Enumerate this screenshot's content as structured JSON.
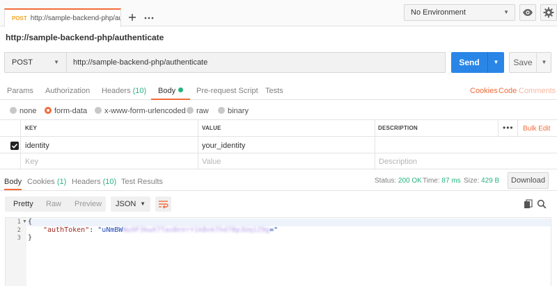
{
  "tabbar": {
    "active_tab": {
      "method": "POST",
      "url": "http://sample-backend-php/au"
    },
    "new_tab_icon": "plus-icon",
    "more_icon": "ellipsis-icon"
  },
  "environment": {
    "selected": "No Environment",
    "eye_icon": "eye-icon",
    "settings_icon": "gear-icon"
  },
  "request": {
    "title": "http://sample-backend-php/authenticate",
    "method": "POST",
    "url": "http://sample-backend-php/authenticate",
    "send_label": "Send",
    "save_label": "Save"
  },
  "request_tabs": {
    "params": "Params",
    "authorization": "Authorization",
    "headers": "Headers",
    "headers_count": "(10)",
    "body": "Body",
    "prerequest": "Pre-request Script",
    "tests": "Tests",
    "cookies": "Cookies",
    "code": "Code",
    "comments": "Comments"
  },
  "body_types": {
    "none": "none",
    "form_data": "form-data",
    "urlencoded": "x-www-form-urlencoded",
    "raw": "raw",
    "binary": "binary",
    "selected": "form-data"
  },
  "kv_table": {
    "headers": {
      "key": "KEY",
      "value": "VALUE",
      "description": "DESCRIPTION",
      "bulk_edit": "Bulk Edit"
    },
    "rows": [
      {
        "checked": true,
        "key": "identity",
        "value": "your_identity",
        "description": ""
      }
    ],
    "placeholder": {
      "key": "Key",
      "value": "Value",
      "description": "Description"
    }
  },
  "response_tabs": {
    "body": "Body",
    "cookies": "Cookies",
    "cookies_count": "(1)",
    "headers": "Headers",
    "headers_count": "(10)",
    "test_results": "Test Results"
  },
  "response_meta": {
    "status_label": "Status:",
    "status_value": "200 OK",
    "time_label": "Time:",
    "time_value": "87 ms",
    "size_label": "Size:",
    "size_value": "429 B",
    "download_label": "Download"
  },
  "response_view": {
    "pretty": "Pretty",
    "raw": "Raw",
    "preview": "Preview",
    "format": "JSON"
  },
  "response_code": {
    "line_numbers": [
      "1",
      "2",
      "3"
    ],
    "open_brace": "{",
    "key": "\"authToken\"",
    "colon": ": ",
    "value_visible": "\"uNmBW",
    "value_redacted": "Nu9F3kwX7TaxBnVrY1kBnkThd7Bp3Uq1Z9g",
    "value_end": "=\"",
    "close_brace": "}"
  },
  "colors": {
    "accent": "#f26b3a",
    "send_button": "#2a86e6",
    "status_green": "#26b47f",
    "method_post": "#f5a623"
  }
}
